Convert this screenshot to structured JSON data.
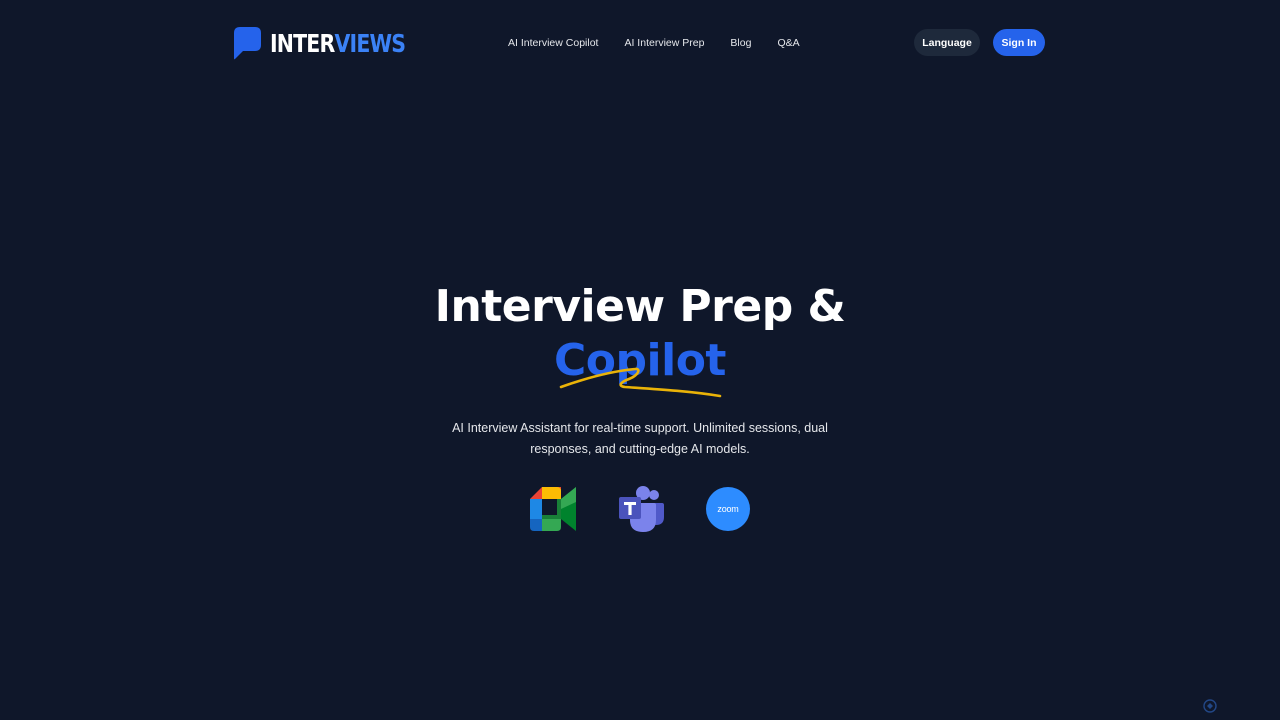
{
  "brand": {
    "name_part1": "INTER",
    "name_part2": "VIEWS",
    "accent_color": "#2563eb",
    "logo_icon": "speech-bubble-icon"
  },
  "nav": {
    "links": [
      {
        "label": "AI Interview Copilot"
      },
      {
        "label": "AI Interview Prep"
      },
      {
        "label": "Blog"
      },
      {
        "label": "Q&A"
      }
    ],
    "language_button": "Language",
    "signin_button": "Sign In"
  },
  "hero": {
    "title_line1": "Interview Prep &",
    "title_line2": "Copilot",
    "title_highlight_color": "#2563eb",
    "underline_color": "#eab308",
    "subtitle": "AI Interview Assistant for real-time support. Unlimited sessions, dual responses, and cutting-edge AI models."
  },
  "platforms": [
    {
      "name": "Google Meet",
      "icon": "google-meet-icon"
    },
    {
      "name": "Microsoft Teams",
      "icon": "microsoft-teams-icon"
    },
    {
      "name": "Zoom",
      "icon": "zoom-icon",
      "label": "zoom"
    }
  ],
  "colors": {
    "background": "#0f172a",
    "language_button_bg": "#1e293b",
    "signin_button_bg": "#2563eb"
  }
}
